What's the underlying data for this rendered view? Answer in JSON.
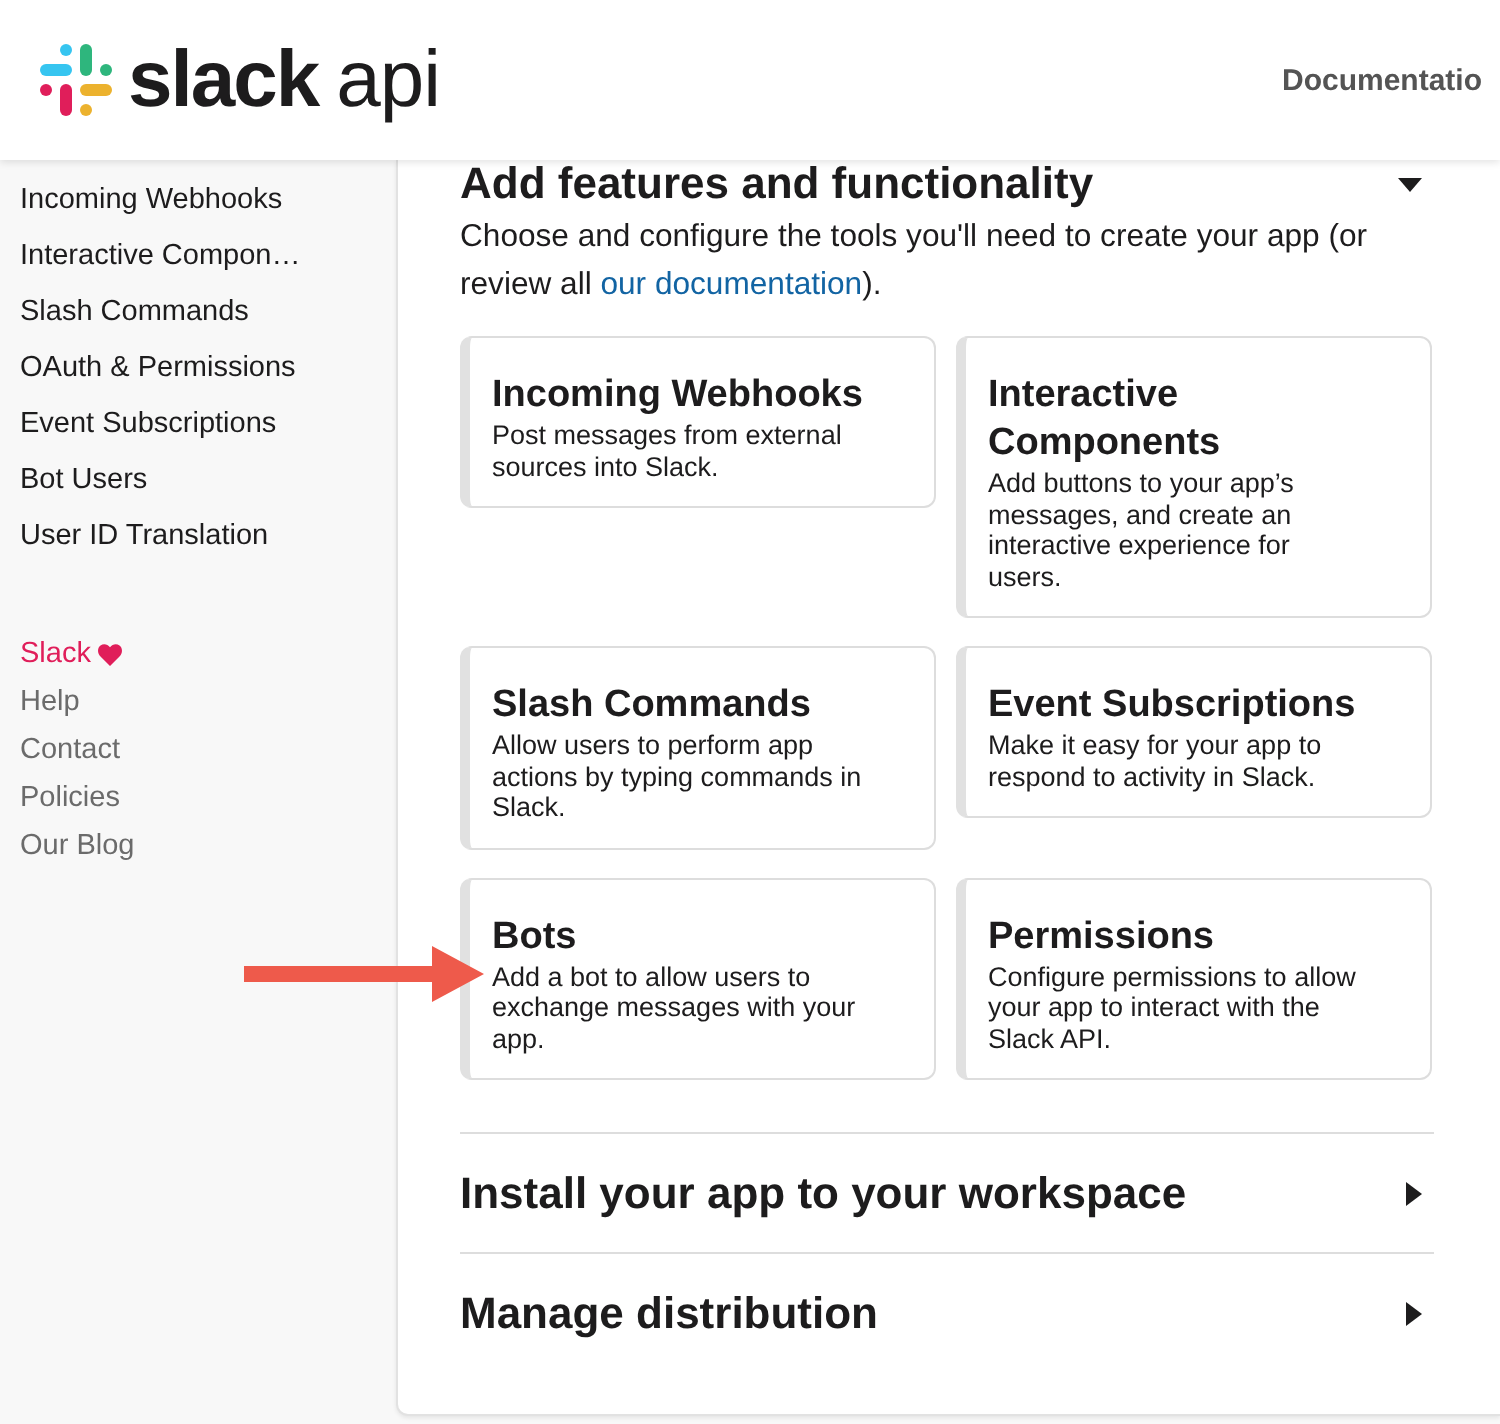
{
  "header": {
    "logo": {
      "wordmark": "slack",
      "suffix": "api"
    },
    "nav": [
      {
        "label": "Documentatio"
      }
    ]
  },
  "sidebar": {
    "items": [
      {
        "label": "Incoming Webhooks"
      },
      {
        "label": "Interactive Compon…"
      },
      {
        "label": "Slash Commands"
      },
      {
        "label": "OAuth & Permissions"
      },
      {
        "label": "Event Subscriptions"
      },
      {
        "label": "Bot Users"
      },
      {
        "label": "User ID Translation"
      }
    ],
    "footer_links": [
      {
        "label": "Slack",
        "kind": "brand"
      },
      {
        "label": "Help",
        "kind": "link"
      },
      {
        "label": "Contact",
        "kind": "link"
      },
      {
        "label": "Policies",
        "kind": "link"
      },
      {
        "label": "Our Blog",
        "kind": "link"
      }
    ]
  },
  "sections": [
    {
      "title": "Add features and functionality",
      "expanded": true,
      "intro": {
        "before": "Choose and configure the tools you'll need to create your app (or review all ",
        "link": "our documentation",
        "after": ")."
      },
      "cards": [
        {
          "title": "Incoming Webhooks",
          "description": "Post messages from external sources into Slack.",
          "marked": false
        },
        {
          "title": "Interactive Components",
          "description": "Add buttons to your app’s messages, and create an interactive experience for users.",
          "marked": false
        },
        {
          "title": "Slash Commands",
          "description": "Allow users to perform app actions by typing commands in Slack.",
          "marked": false
        },
        {
          "title": "Event Subscriptions",
          "description": "Make it easy for your app to respond to activity in Slack.",
          "marked": false
        },
        {
          "title": "Bots",
          "description": "Add a bot to allow users to exchange messages with your app.",
          "marked": true
        },
        {
          "title": "Permissions",
          "description": "Configure permissions to allow your app to interact with the Slack API.",
          "marked": false
        }
      ]
    },
    {
      "title": "Install your app to your workspace",
      "expanded": false
    },
    {
      "title": "Manage distribution",
      "expanded": false
    }
  ]
}
